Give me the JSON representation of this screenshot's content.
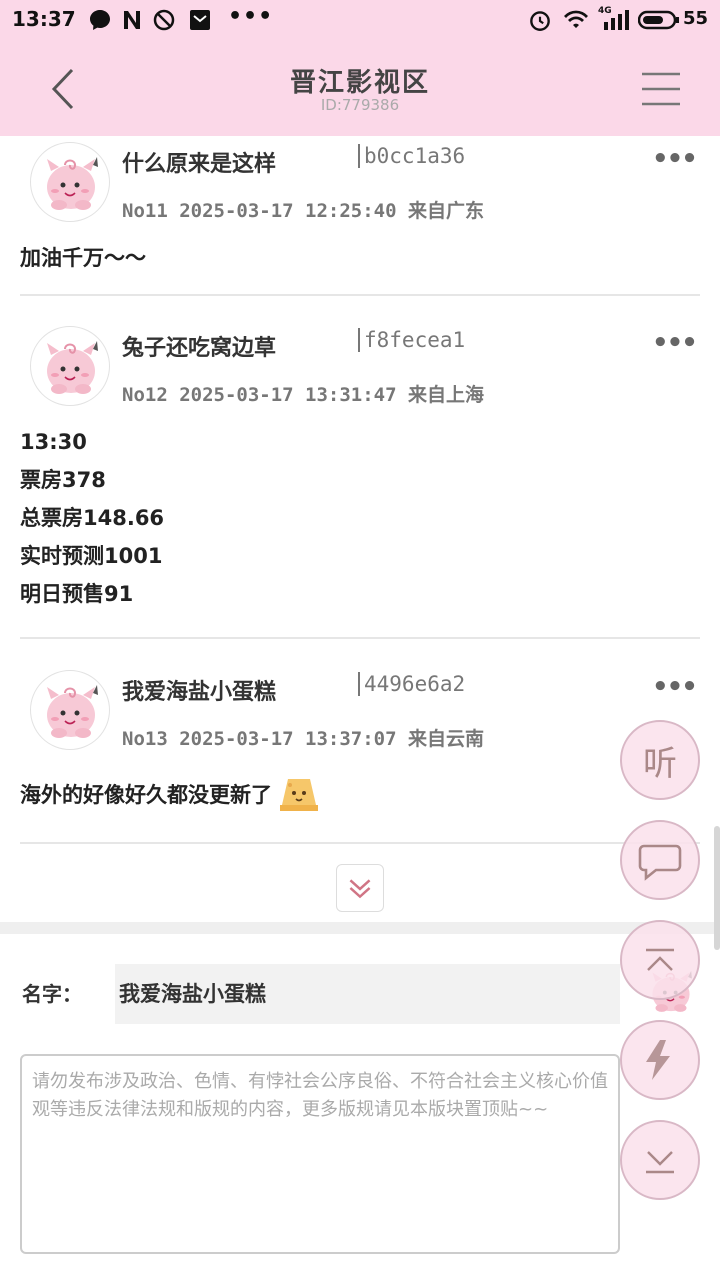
{
  "status_bar": {
    "time": "13:37",
    "more": "•••",
    "network": "4G",
    "battery": "55",
    "icons": [
      "chat-bubble-icon",
      "n-icon",
      "blocked-icon",
      "mail-icon",
      "alarm-icon",
      "wifi-icon",
      "signal-icon",
      "battery-icon"
    ]
  },
  "header": {
    "title": "晋江影视区",
    "board_id": "ID:779386",
    "back_icon": "chevron-left-icon",
    "menu_icon": "hamburger-menu-icon"
  },
  "posts": [
    {
      "name": "什么原来是这样",
      "hash": "b0cc1a36",
      "meta": "No11 2025-03-17 12:25:40 来自广东",
      "lines": [
        "加油千万～～"
      ],
      "more": "•••"
    },
    {
      "name": "兔子还吃窝边草",
      "hash": "f8fecea1",
      "meta": "No12 2025-03-17 13:31:47 来自上海",
      "lines": [
        "13:30",
        "票房378",
        "总票房148.66",
        "实时预测1001",
        "明日预售91"
      ],
      "more": "•••"
    },
    {
      "name": "我爱海盐小蛋糕",
      "hash": "4496e6a2",
      "meta": "No13 2025-03-17 13:37:07 来自云南",
      "lines": [
        "海外的好像好久都没更新了"
      ],
      "more": "•••",
      "emoji": "cheese-emoji-icon"
    }
  ],
  "expand_icon": "double-chevron-down-icon",
  "reply_form": {
    "name_label": "名字：",
    "name_value": "我爱海盐小蛋糕",
    "content_placeholder": "请勿发布涉及政治、色情、有悖社会公序良俗、不符合社会主义核心价值观等违反法律法规和版规的内容，更多版规请见本版块置顶贴~~"
  },
  "floating_buttons": {
    "listen_label": "听",
    "comment_icon": "comment-icon",
    "top_icon": "scroll-top-icon",
    "refresh_icon": "refresh-icon",
    "bottom_icon": "scroll-bottom-icon"
  },
  "colors": {
    "header_bg": "#fbd8e8",
    "fab_bg": "#fae1eb",
    "fab_border": "#d9b8c6",
    "accent": "#c98a9a"
  }
}
